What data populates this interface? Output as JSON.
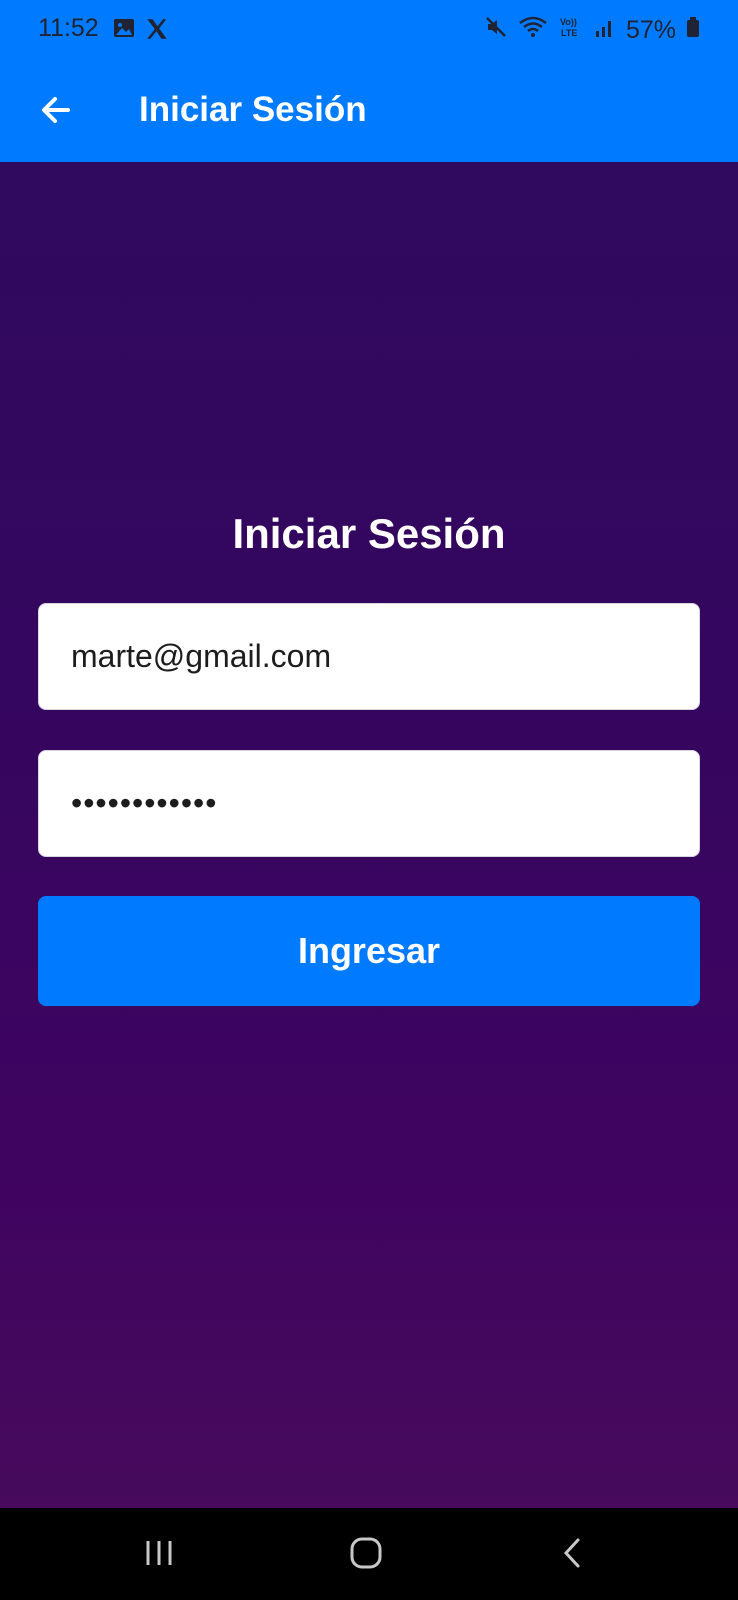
{
  "status_bar": {
    "time": "11:52",
    "left_icons": [
      "gallery-icon",
      "x-logo-icon"
    ],
    "right_icons": [
      "mute-icon",
      "wifi-icon",
      "volte-icon",
      "signal-icon"
    ],
    "battery": "57%"
  },
  "app_bar": {
    "title": "Iniciar Sesión"
  },
  "form": {
    "title": "Iniciar Sesión",
    "email_value": "marte@gmail.com",
    "password_value": "••••••••••••",
    "submit_label": "Ingresar"
  },
  "colors": {
    "primary": "#007bff",
    "background_top": "#2f0a5e",
    "background_bottom": "#470a5c"
  },
  "nav_bar": {
    "buttons": [
      "recents-icon",
      "home-icon",
      "back-icon"
    ]
  }
}
